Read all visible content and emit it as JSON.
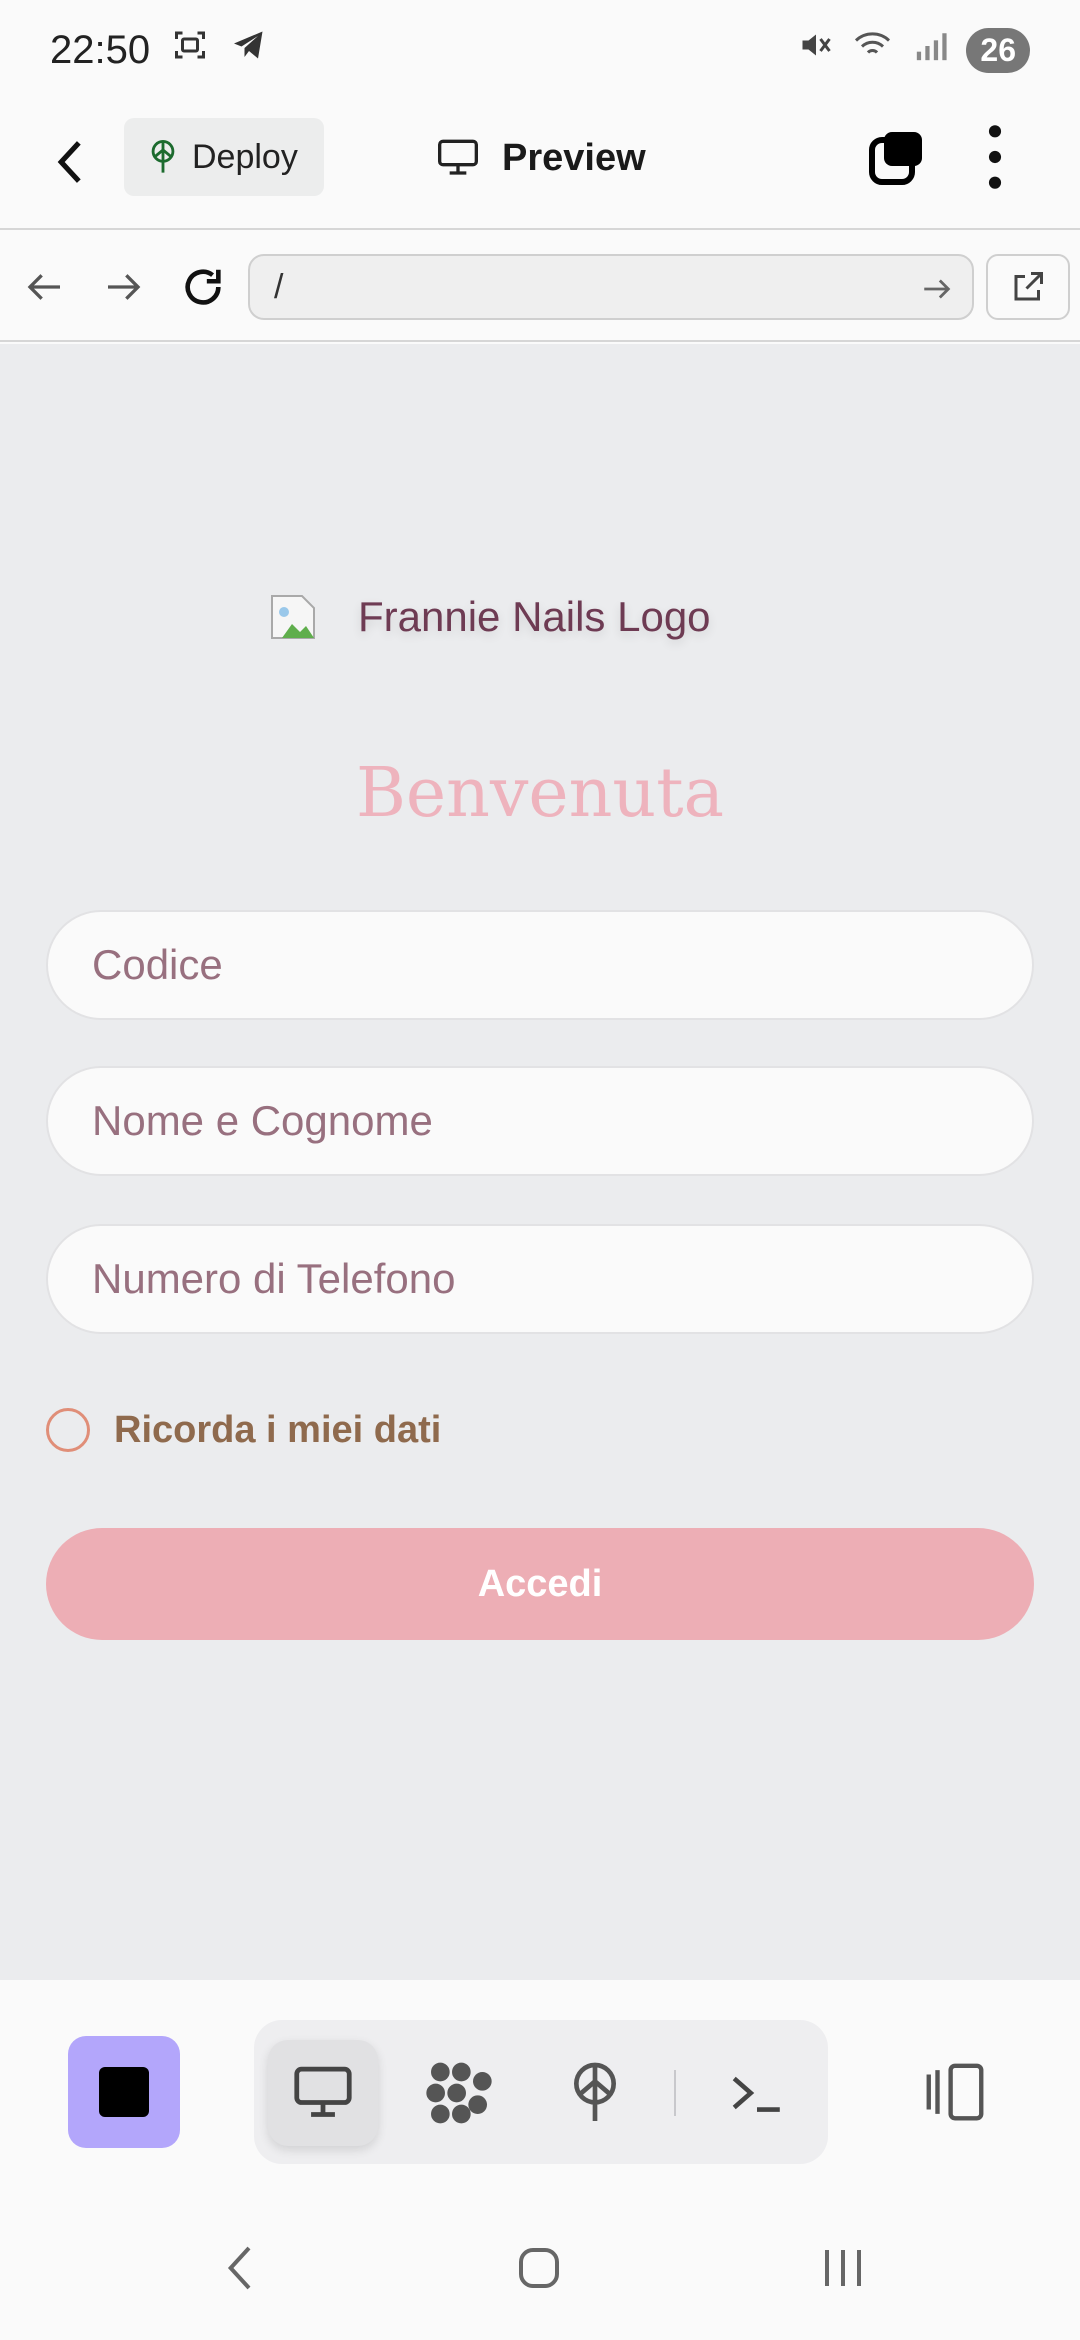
{
  "status_bar": {
    "time": "22:50",
    "battery": "26",
    "icons": [
      "screenshot-icon",
      "telegram-icon",
      "mute-icon",
      "wifi-icon",
      "signal-icon"
    ]
  },
  "header": {
    "deploy_label": "Deploy",
    "title": "Preview"
  },
  "url_bar": {
    "url": "/"
  },
  "page": {
    "logo_alt": "Frannie Nails Logo",
    "welcome": "Benvenuta",
    "fields": {
      "code_placeholder": "Codice",
      "name_placeholder": "Nome e Cognome",
      "phone_placeholder": "Numero di Telefono"
    },
    "remember_label": "Ricorda i miei dati",
    "submit_label": "Accedi"
  },
  "colors": {
    "accent_purple": "#b3a6fb",
    "button_pink": "#edaeb5",
    "welcome_pink": "#eeb3bd",
    "content_bg": "#ebecee"
  }
}
